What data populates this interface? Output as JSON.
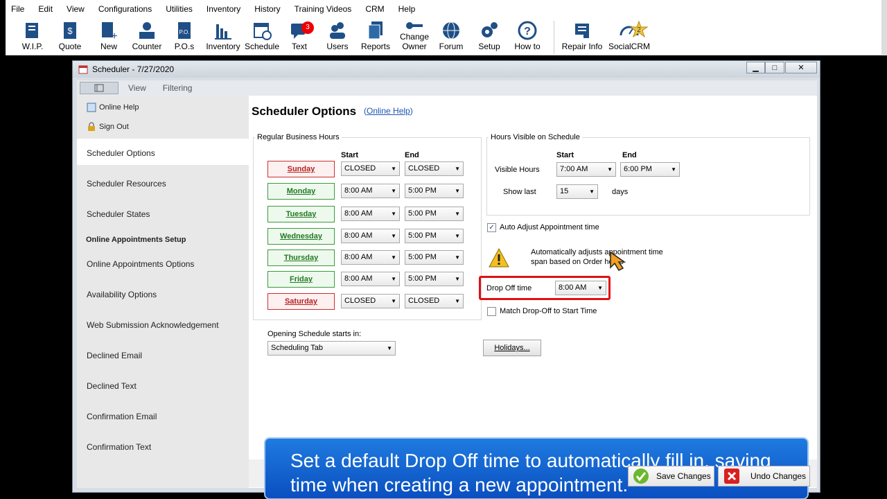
{
  "menu": [
    "File",
    "Edit",
    "View",
    "Configurations",
    "Utilities",
    "Inventory",
    "History",
    "Training Videos",
    "CRM",
    "Help"
  ],
  "toolbar": {
    "wip": "W.I.P.",
    "quote": "Quote",
    "new": "New",
    "counter": "Counter",
    "pos": "P.O.s",
    "inventory": "Inventory",
    "schedule": "Schedule",
    "text": "Text",
    "text_badge": "3",
    "users": "Users",
    "reports": "Reports",
    "change_owner": "Change Owner",
    "forum": "Forum",
    "setup": "Setup",
    "howto": "How to",
    "repair": "Repair Info",
    "socialcrm": "SocialCRM",
    "social_badge": "2"
  },
  "window": {
    "title": "Scheduler - 7/27/2020",
    "tab_view": "View",
    "tab_filtering": "Filtering"
  },
  "sidebar": {
    "help": "Online Help",
    "signout": "Sign Out",
    "items": [
      "Scheduler Options",
      "Scheduler Resources",
      "Scheduler States"
    ],
    "section": "Online Appointments Setup",
    "online": [
      "Online Appointments Options",
      "Availability Options",
      "Web Submission Acknowledgement",
      "Declined Email",
      "Declined Text",
      "Confirmation Email",
      "Confirmation Text"
    ]
  },
  "main": {
    "title": "Scheduler Options",
    "help_link": "Online Help",
    "business": {
      "legend": "Regular Business Hours",
      "start": "Start",
      "end": "End",
      "days": [
        {
          "name": "Sunday",
          "start": "CLOSED",
          "end": "CLOSED",
          "open": false
        },
        {
          "name": "Monday",
          "start": "8:00 AM",
          "end": "5:00 PM",
          "open": true
        },
        {
          "name": "Tuesday",
          "start": "8:00 AM",
          "end": "5:00 PM",
          "open": true
        },
        {
          "name": "Wednesday",
          "start": "8:00 AM",
          "end": "5:00 PM",
          "open": true
        },
        {
          "name": "Thursday",
          "start": "8:00 AM",
          "end": "5:00 PM",
          "open": true
        },
        {
          "name": "Friday",
          "start": "8:00 AM",
          "end": "5:00 PM",
          "open": true
        },
        {
          "name": "Saturday",
          "start": "CLOSED",
          "end": "CLOSED",
          "open": false
        }
      ]
    },
    "visible": {
      "legend": "Hours Visible on Schedule",
      "start": "Start",
      "end": "End",
      "label": "Visible Hours",
      "start_val": "7:00 AM",
      "end_val": "6:00 PM",
      "show_last": "Show last",
      "show_val": "15",
      "days": "days"
    },
    "auto_adjust": "Auto Adjust Appointment time",
    "warning": "Automatically adjusts appointment time span based on Order hours",
    "drop_off_label": "Drop Off time",
    "drop_off_val": "8:00 AM",
    "match": "Match Drop-Off to Start Time",
    "opening_label": "Opening Schedule starts in:",
    "opening_val": "Scheduling Tab",
    "holidays": "Holidays...",
    "banner": "Set a default Drop Off time to automatically fill in, saving time when creating a new appointment.",
    "save": "Save Changes",
    "undo": "Undo Changes"
  }
}
